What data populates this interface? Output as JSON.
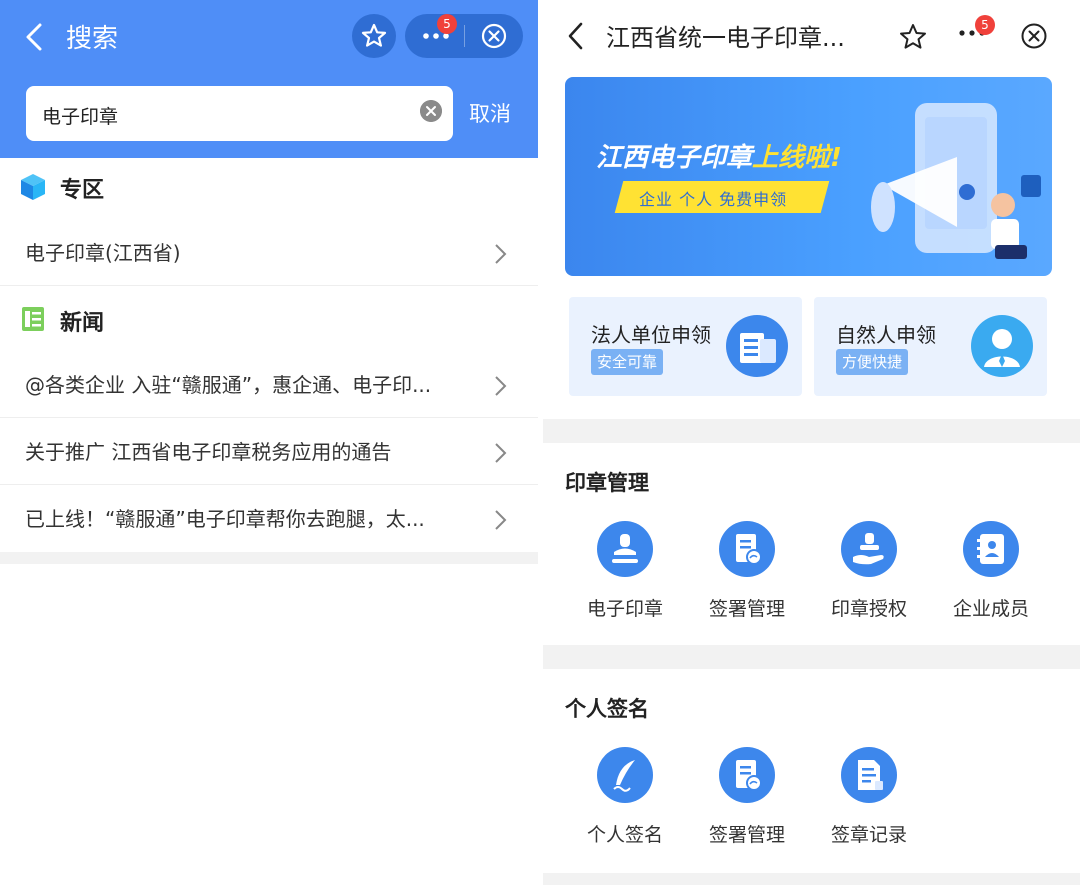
{
  "left": {
    "header": {
      "title": "搜索",
      "badge_count": "5",
      "search_value": "电子印章",
      "cancel_label": "取消"
    },
    "special_section": {
      "title": "专区",
      "items": [
        {
          "label": "电子印章(江西省)"
        }
      ]
    },
    "news_section": {
      "title": "新闻",
      "items": [
        {
          "label": "@各类企业 入驻“赣服通”，惠企通、电子印..."
        },
        {
          "label": "关于推广 江西省电子印章税务应用的通告"
        },
        {
          "label": "已上线！“赣服通”电子印章帮你去跑腿，太..."
        }
      ]
    }
  },
  "right": {
    "header": {
      "title": "江西省统一电子印章...",
      "badge_count": "5"
    },
    "banner": {
      "title_white": "江西电子印章",
      "title_yellow": "上线啦",
      "title_excl": "!",
      "tag": "企业 个人 免费申领"
    },
    "cards": [
      {
        "title": "法人单位申领",
        "tag": "安全可靠",
        "icon": "building-icon"
      },
      {
        "title": "自然人申领",
        "tag": "方便快捷",
        "icon": "person-icon"
      }
    ],
    "seal_management": {
      "title": "印章管理",
      "items": [
        {
          "label": "电子印章",
          "icon": "seal-icon"
        },
        {
          "label": "签署管理",
          "icon": "document-sign-icon"
        },
        {
          "label": "印章授权",
          "icon": "seal-hand-icon"
        },
        {
          "label": "企业成员",
          "icon": "contacts-icon"
        }
      ]
    },
    "personal_signature": {
      "title": "个人签名",
      "items": [
        {
          "label": "个人签名",
          "icon": "feather-pen-icon"
        },
        {
          "label": "签署管理",
          "icon": "document-sign-icon"
        },
        {
          "label": "签章记录",
          "icon": "record-icon"
        }
      ]
    }
  },
  "colors": {
    "primary_blue": "#4f8ef7",
    "dark_blue": "#2f6dd3",
    "icon_blue": "#3d87ec",
    "badge_red": "#f0413b",
    "banner_yellow": "#ffe233"
  }
}
